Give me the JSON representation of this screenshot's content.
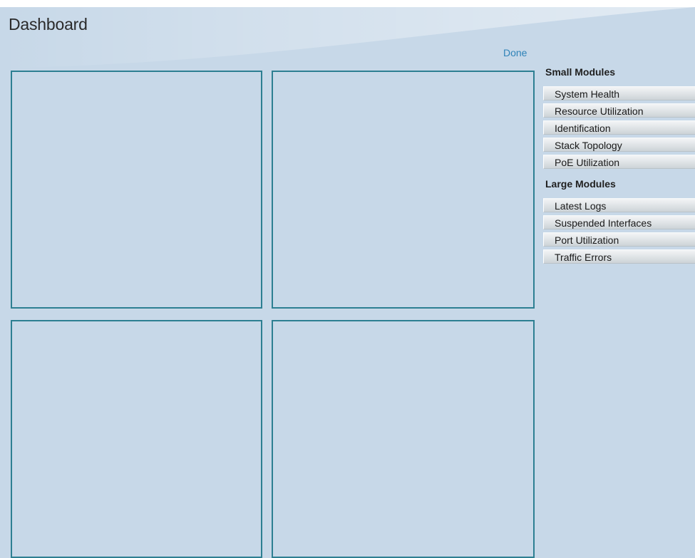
{
  "header": {
    "title": "Dashboard",
    "done_label": "Done"
  },
  "colors": {
    "background": "#c7d8e8",
    "slot_border": "#2d7f92",
    "link": "#2f83b8"
  },
  "small_modules": {
    "heading": "Small Modules",
    "items": [
      {
        "label": "System Health"
      },
      {
        "label": "Resource Utilization"
      },
      {
        "label": "Identification"
      },
      {
        "label": "Stack Topology"
      },
      {
        "label": "PoE Utilization"
      }
    ]
  },
  "large_modules": {
    "heading": "Large Modules",
    "items": [
      {
        "label": "Latest Logs"
      },
      {
        "label": "Suspended Interfaces"
      },
      {
        "label": "Port Utilization"
      },
      {
        "label": "Traffic Errors"
      }
    ]
  }
}
